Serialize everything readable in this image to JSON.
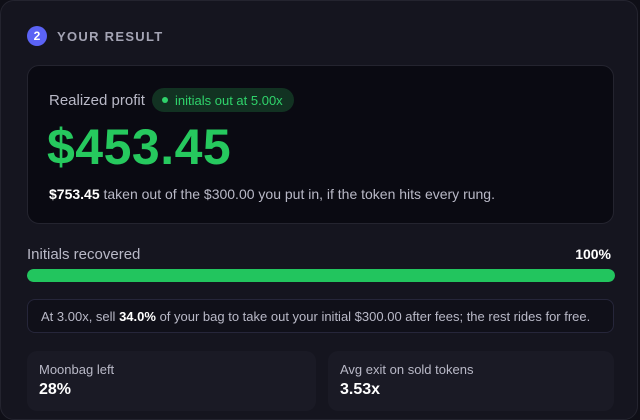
{
  "step": {
    "number": "2",
    "title": "YOUR RESULT"
  },
  "result": {
    "label": "Realized profit",
    "badge": "initials out at 5.00x",
    "profit": "$453.45",
    "taken_out": "$753.45",
    "desc_middle": " taken out of the ",
    "put_in": "$300.00",
    "desc_end": " you put in, if the token hits every rung."
  },
  "recovery": {
    "label": "Initials recovered",
    "percent_text": "100%",
    "fraction": 1.0
  },
  "info": {
    "part1": "At 3.00x, sell ",
    "sell_pct": "34.0%",
    "part2": " of your bag to take out your initial $300.00 after fees; the rest rides for free."
  },
  "stats": [
    {
      "label": "Moonbag left",
      "value": "28%"
    },
    {
      "label": "Avg exit on sold tokens",
      "value": "3.53x"
    }
  ],
  "colors": {
    "accent_green": "#26c95e",
    "step_badge": "#5b63f5",
    "badge_bg": "#123222"
  },
  "icons": {
    "badge_dot": "status-dot-icon"
  }
}
